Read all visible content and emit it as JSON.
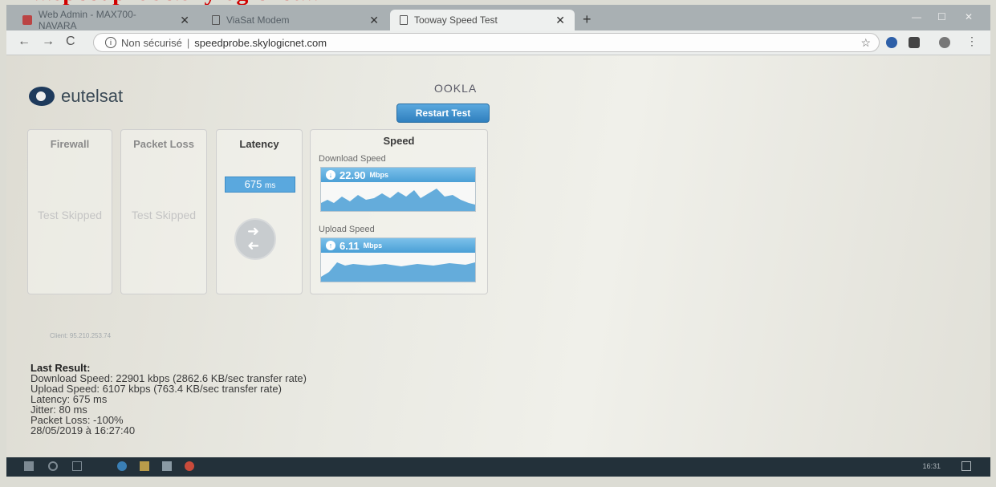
{
  "overlay_caption": "...speedprobe.skylogicnet...",
  "browser": {
    "tabs": [
      {
        "label": "Web Admin - MAX700-NAVARA",
        "active": false
      },
      {
        "label": "ViaSat Modem",
        "active": false
      },
      {
        "label": "Tooway Speed Test",
        "active": true
      }
    ],
    "new_tab": "+",
    "address": {
      "security_label": "Non sécurisé",
      "url": "speedprobe.skylogicnet.com"
    }
  },
  "page": {
    "brand": "eutelsat",
    "provider": "OOKLA",
    "restart_button": "Restart Test",
    "panels": {
      "firewall": {
        "title": "Firewall",
        "status": "Test Skipped"
      },
      "packet_loss": {
        "title": "Packet Loss",
        "status": "Test Skipped"
      },
      "latency": {
        "title": "Latency",
        "value": "675",
        "unit": "ms"
      },
      "speed": {
        "title": "Speed",
        "download_label": "Download Speed",
        "download_value": "22.90",
        "upload_label": "Upload Speed",
        "upload_value": "6.11",
        "unit": "Mbps"
      }
    },
    "client": "Client: 95.210.253.74",
    "last_result": {
      "title": "Last Result:",
      "download": "Download Speed: 22901 kbps (2862.6 KB/sec transfer rate)",
      "upload": "Upload Speed: 6107 kbps (763.4 KB/sec transfer rate)",
      "latency": "Latency: 675 ms",
      "jitter": "Jitter: 80 ms",
      "packet_loss": "Packet Loss: -100%",
      "timestamp": "28/05/2019 à 16:27:40"
    }
  },
  "taskbar": {
    "clock": "16:31"
  },
  "colors": {
    "accent": "#4a9fd6",
    "button": "#2f7fbe"
  }
}
